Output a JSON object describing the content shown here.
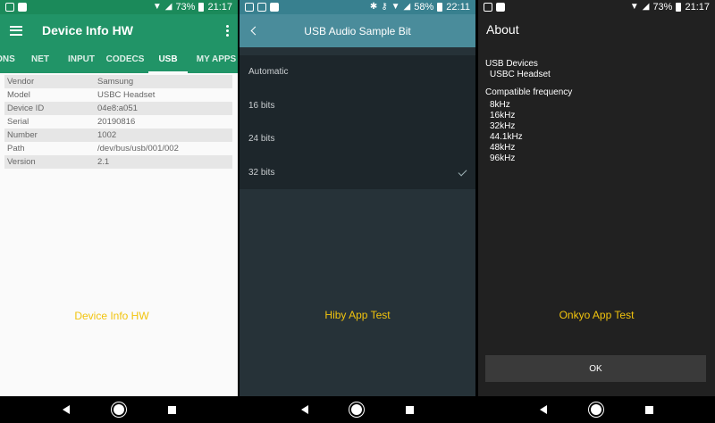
{
  "panel1": {
    "status": {
      "battery": "73%",
      "time": "21:17"
    },
    "title": "Device Info HW",
    "tabs": [
      {
        "label": "ONS"
      },
      {
        "label": "NET"
      },
      {
        "label": "INPUT"
      },
      {
        "label": "CODECS"
      },
      {
        "label": "USB"
      },
      {
        "label": "MY APPS"
      }
    ],
    "active_tab": "USB",
    "rows": [
      {
        "key": "Vendor",
        "value": "Samsung"
      },
      {
        "key": "Model",
        "value": "USBC Headset"
      },
      {
        "key": "Device ID",
        "value": "04e8:a051"
      },
      {
        "key": "Serial",
        "value": "20190816"
      },
      {
        "key": "Number",
        "value": "1002"
      },
      {
        "key": "Path",
        "value": "/dev/bus/usb/001/002"
      },
      {
        "key": "Version",
        "value": "2.1"
      }
    ],
    "caption": "Device Info HW",
    "colors": {
      "appbar": "#219467",
      "caption": "#f2c40d"
    }
  },
  "panel2": {
    "status": {
      "battery": "58%",
      "time": "22:11"
    },
    "title": "USB Audio Sample Bit",
    "options": [
      {
        "label": "Automatic",
        "selected": false
      },
      {
        "label": "16 bits",
        "selected": false
      },
      {
        "label": "24 bits",
        "selected": false
      },
      {
        "label": "32 bits",
        "selected": true
      }
    ],
    "caption": "Hiby App Test",
    "colors": {
      "appbar": "#4a8c9b",
      "background": "#263238"
    }
  },
  "panel3": {
    "status": {
      "battery": "73%",
      "time": "21:17"
    },
    "title": "About",
    "usb_devices_heading": "USB Devices",
    "usb_device": "USBC Headset",
    "freq_heading": "Compatible frequency",
    "frequencies": [
      "8kHz",
      "16kHz",
      "32kHz",
      "44.1kHz",
      "48kHz",
      "96kHz"
    ],
    "caption": "Onkyo App Test",
    "ok_label": "OK"
  }
}
